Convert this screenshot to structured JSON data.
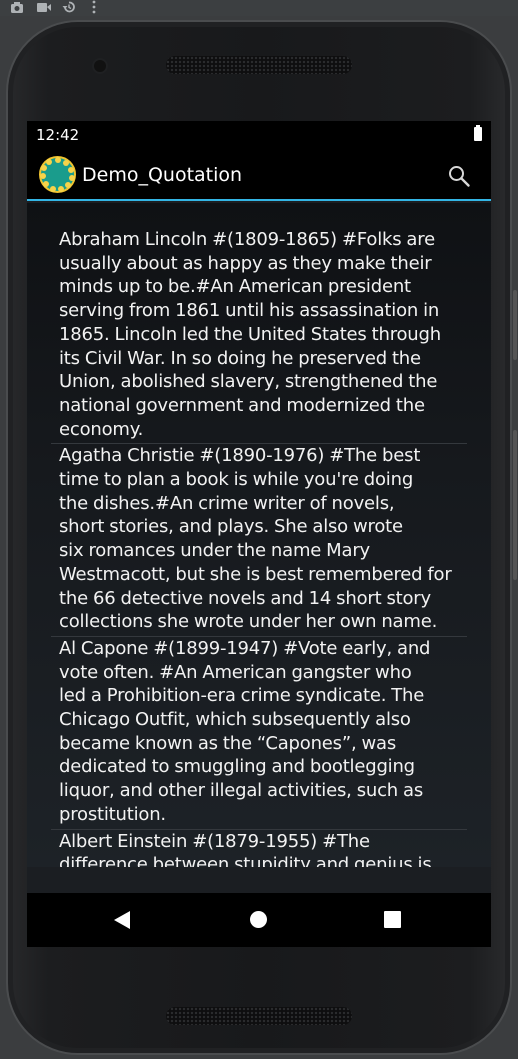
{
  "status_bar": {
    "time": "12:42"
  },
  "action_bar": {
    "title": "Demo_Quotation"
  },
  "quotes": [
    {
      "lines": [
        "Abraham Lincoln #(1809-1865) #Folks are",
        "usually about as happy as they make their",
        "minds up to be.#An American president",
        "serving from 1861 until his assassination in",
        "1865. Lincoln led the United States through",
        "its Civil War. In so doing he preserved the",
        "Union, abolished slavery, strengthened the",
        "national government and modernized the",
        "economy."
      ]
    },
    {
      "lines": [
        "Agatha Christie #(1890-1976) #The best",
        "time to plan a book is while you're doing",
        "the dishes.#An crime writer of novels,",
        "short stories, and plays. She also wrote",
        "six romances under the name Mary",
        "Westmacott, but she is best remembered for",
        "the 66 detective novels and 14 short story",
        "collections she wrote under her own name."
      ]
    },
    {
      "lines": [
        "Al Capone #(1899-1947) #Vote early, and",
        "vote often. #An American gangster who",
        "led a Prohibition-era crime syndicate. The",
        "Chicago Outfit, which subsequently also",
        "became known as the “Capones”, was",
        "dedicated to smuggling and bootlegging",
        "liquor, and other illegal activities, such as",
        "prostitution."
      ]
    },
    {
      "lines": [
        "Albert Einstein #(1879-1955) #The",
        "difference between stupidity and genius is"
      ]
    }
  ],
  "icons": {
    "toolbar": [
      "camera-icon",
      "video-icon",
      "history-icon",
      "more-vert-icon"
    ],
    "status": [
      "battery-icon"
    ],
    "action": [
      "app-logo-icon",
      "search-icon"
    ],
    "nav": [
      "back-icon",
      "home-icon",
      "recents-icon"
    ]
  },
  "colors": {
    "accent": "#33b5e5",
    "app_icon_teal": "#1a9c8c",
    "app_icon_gold": "#f0c430"
  }
}
